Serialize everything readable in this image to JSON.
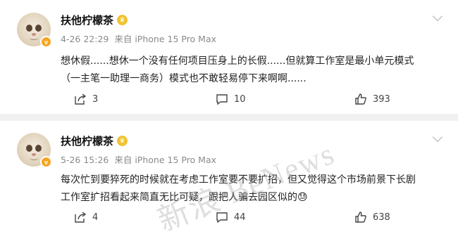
{
  "posts": [
    {
      "username": "扶他柠檬茶",
      "date": "4-26 22:29",
      "source": "来自 iPhone 15 Pro Max",
      "content_lines": [
        "想休假......想休一个没有任何项目压身上的长假......但就算工作室是最小单元模式",
        "（一主笔一助理一商务）模式也不敢轻易停下来啊啊......"
      ],
      "reposts": "3",
      "comments": "10",
      "likes": "393"
    },
    {
      "username": "扶他柠檬茶",
      "date": "5-26 15:26",
      "source": "来自 iPhone 15 Pro Max",
      "content_lines": [
        "每次忙到要猝死的时候就在考虑工作室要不要扩招，但又觉得这个市场前景下长剧",
        "工作室扩招看起来简直无比可疑，跟把人骗去园区似的😓"
      ],
      "reposts": "4",
      "comments": "44",
      "likes": "638"
    }
  ],
  "watermark": "新浪 BeNews",
  "icons": {
    "verified_badge": "v-badge-icon",
    "member_crown": "crown-icon",
    "share": "share-icon",
    "comment": "comment-icon",
    "like": "thumbs-up-icon",
    "more": "chevron-down-icon"
  },
  "colors": {
    "verified": "#f5a623",
    "crown": "#f1c232",
    "meta_text": "#8a8a8a"
  }
}
